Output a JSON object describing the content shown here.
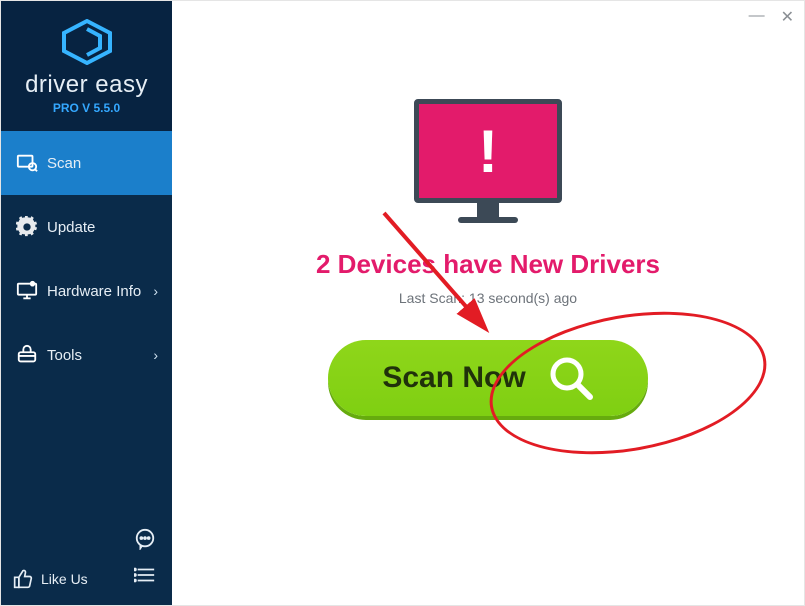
{
  "brand": {
    "name": "driver easy",
    "version": "PRO V 5.5.0"
  },
  "sidebar": {
    "items": [
      {
        "label": "Scan",
        "has_chevron": false
      },
      {
        "label": "Update",
        "has_chevron": false
      },
      {
        "label": "Hardware Info",
        "has_chevron": true
      },
      {
        "label": "Tools",
        "has_chevron": true
      }
    ],
    "like_label": "Like Us"
  },
  "main": {
    "headline": "2 Devices have New Drivers",
    "last_scan": "Last Scan: 13 second(s) ago",
    "scan_button": "Scan Now"
  },
  "window": {
    "minimize": "—",
    "close": "✕"
  }
}
